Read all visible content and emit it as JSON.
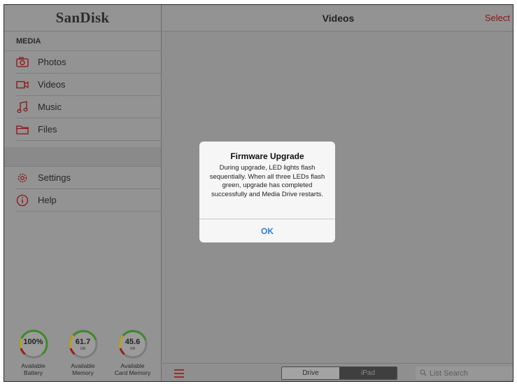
{
  "sidebar": {
    "logo": "SanDisk",
    "section_label": "MEDIA",
    "items": [
      {
        "label": "Photos",
        "icon": "camera-icon"
      },
      {
        "label": "Videos",
        "icon": "video-camera-icon"
      },
      {
        "label": "Music",
        "icon": "music-note-icon"
      },
      {
        "label": "Files",
        "icon": "folder-icon"
      }
    ],
    "settings_items": [
      {
        "label": "Settings",
        "icon": "gear-icon"
      },
      {
        "label": "Help",
        "icon": "info-icon"
      }
    ],
    "gauges": [
      {
        "value": "100%",
        "unit": "",
        "caption_line1": "Available",
        "caption_line2": "Battery",
        "level": 1.0
      },
      {
        "value": "61.7",
        "unit": "GB",
        "caption_line1": "Available",
        "caption_line2": "Memory",
        "level": 0.72
      },
      {
        "value": "45.6",
        "unit": "GB",
        "caption_line1": "Available",
        "caption_line2": "Card Memory",
        "level": 0.72
      }
    ]
  },
  "header": {
    "title": "Videos",
    "select_label": "Select"
  },
  "toolbar": {
    "menu_icon": "hamburger-menu-icon",
    "segment_drive": "Drive",
    "segment_ipad": "iPad",
    "search_placeholder": "List Search"
  },
  "dialog": {
    "title": "Firmware Upgrade",
    "message": "During upgrade, LED lights flash sequentially. When all three LEDs flash green, upgrade has completed successfully and Media Drive restarts.",
    "ok_label": "OK"
  },
  "colors": {
    "accent_red": "#8e1212",
    "link_blue": "#2f7bd6",
    "gauge_green": "#3f8a2a",
    "gauge_yellow": "#b6a21c",
    "gauge_red": "#9a1f1f"
  }
}
